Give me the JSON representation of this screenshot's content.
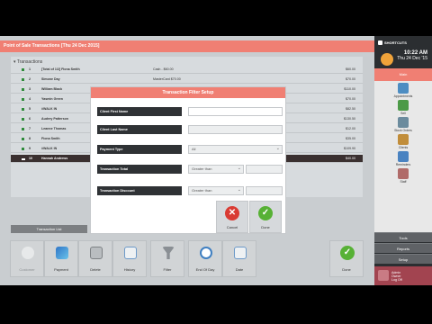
{
  "window": {
    "title": "Point of Sale Transactions [Thu 24 Dec 2015]"
  },
  "transactions": {
    "header": "Transactions",
    "rows": [
      {
        "num": "1",
        "name": "[Total of 1/2] Fiona Smith",
        "payment": "Cash - $60.00",
        "amount": "$60.00"
      },
      {
        "num": "2",
        "name": "Simone Day",
        "payment": "MasterCard $70.00",
        "amount": "$70.00"
      },
      {
        "num": "3",
        "name": "William Black",
        "payment": "",
        "amount": "$110.00"
      },
      {
        "num": "4",
        "name": "Yasmin Green",
        "payment": "",
        "amount": "$70.00"
      },
      {
        "num": "5",
        "name": "#WALK IN",
        "payment": "",
        "amount": "$82.50"
      },
      {
        "num": "6",
        "name": "Audrey Patterson",
        "payment": "",
        "amount": "$130.50"
      },
      {
        "num": "7",
        "name": "Leanne Thomas",
        "payment": "",
        "amount": "$12.00"
      },
      {
        "num": "8",
        "name": "Fiona Smith",
        "payment": "",
        "amount": "$35.00"
      },
      {
        "num": "9",
        "name": "#WALK IN",
        "payment": "",
        "amount": "$109.90"
      },
      {
        "num": "10",
        "name": "Hannah Andrews",
        "payment": "",
        "amount": "$40.00",
        "selected": true
      }
    ]
  },
  "list_button": "Transaction List",
  "toolbar": {
    "customer": "Customer",
    "payment": "Payment",
    "delete": "Delete",
    "history": "History",
    "filter": "Filter",
    "end_of_day": "End Of Day",
    "date": "Date",
    "done": "Done"
  },
  "dialog": {
    "title": "Transaction Filter Setup",
    "labels": {
      "first_name": "Client First Name",
      "last_name": "Client Last Name",
      "payment_type": "Payment Type",
      "total": "Transaction Total",
      "discount": "Transaction Discount"
    },
    "values": {
      "payment_type": "All",
      "total_op": "Greater than",
      "discount_op": "Greater than"
    },
    "cancel": "Cancel",
    "done": "Done"
  },
  "sidebar": {
    "brand": "SHORTCUTS",
    "time": "10:22 AM",
    "date": "Thu 24 Dec '15",
    "top_strip": "Main",
    "items": [
      {
        "label": "Appointments"
      },
      {
        "label": "Sell"
      },
      {
        "label": "Stock Orders"
      },
      {
        "label": "Clients"
      },
      {
        "label": "Reminders"
      },
      {
        "label": "Staff"
      }
    ],
    "buttons": [
      "Tools",
      "Reports",
      "Setup"
    ],
    "user": {
      "line1": "Admin",
      "line2": "Owner",
      "line3": "Log Off"
    }
  },
  "colors": {
    "accent": "#f07f73",
    "panel_dark": "#2b2e31",
    "selected_row": "#3a3030",
    "cancel_red": "#d93b33",
    "done_green": "#57b135"
  },
  "icons": {
    "customer": "person-icon",
    "payment": "card-globe-icon",
    "delete": "trash-icon",
    "history": "calendar-icon",
    "filter": "funnel-icon",
    "end_of_day": "clock-icon",
    "date": "calendar-icon",
    "done": "checkmark-icon",
    "cancel": "x-circle-icon"
  }
}
